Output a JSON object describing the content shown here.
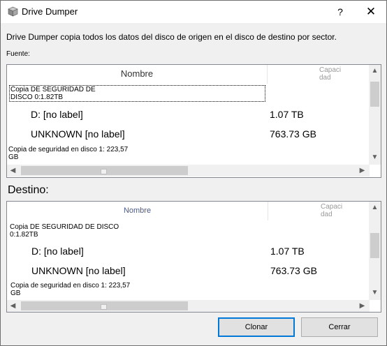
{
  "window": {
    "title": "Drive Dumper",
    "help_label": "?",
    "close_glyph": "✕",
    "icon": "cube-icon"
  },
  "description": "Drive Dumper copia todos los datos del disco de origen en el disco de destino por sector.",
  "source": {
    "label": "Fuente:",
    "columns": {
      "name": "Nombre",
      "capacity_line1": "Capaci",
      "capacity_line2": "dad"
    },
    "group_title_line1": "Copia DE SEGURIDAD DE",
    "group_title_line2": "DISCO 0:1.82TB",
    "rows": [
      {
        "name": "D: [no label]",
        "size": "1.07 TB"
      },
      {
        "name": "UNKNOWN [no label]",
        "size": "763.73 GB"
      }
    ],
    "footer_line1": "Copia de seguridad en disco 1: 223,57",
    "footer_line2": "GB"
  },
  "destination": {
    "label": "Destino:",
    "columns": {
      "name": "Nombre",
      "capacity_line1": "Capaci",
      "capacity_line2": "dad"
    },
    "group_title_line1": "Copia DE SEGURIDAD DE DISCO",
    "group_title_line2": "0:1.82TB",
    "rows": [
      {
        "name": "D: [no label]",
        "size": "1.07 TB"
      },
      {
        "name": "UNKNOWN [no label]",
        "size": "763.73 GB"
      }
    ],
    "footer_line1": "Copia de seguridad en disco 1: 223,57",
    "footer_line2": "GB"
  },
  "buttons": {
    "clone": "Clonar",
    "close": "Cerrar"
  },
  "icons": {
    "up": "▲",
    "down": "▼",
    "left": "◀",
    "right": "▶"
  },
  "colors": {
    "accent": "#0078d7",
    "border": "#828790"
  }
}
